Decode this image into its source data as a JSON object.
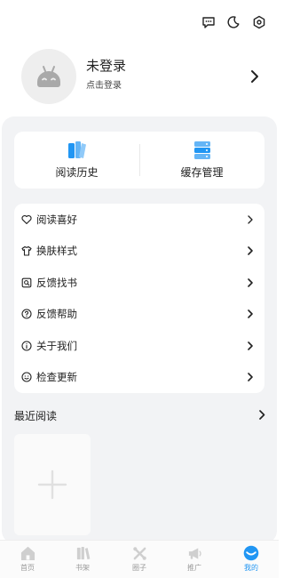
{
  "header": {
    "icons": [
      "message-icon",
      "night-mode-icon",
      "settings-icon"
    ]
  },
  "profile": {
    "name": "未登录",
    "hint": "点击登录"
  },
  "quick_actions": [
    {
      "label": "阅读历史",
      "icon": "book-icon"
    },
    {
      "label": "缓存管理",
      "icon": "database-icon"
    }
  ],
  "menu": [
    {
      "label": "阅读喜好",
      "icon": "heart-icon"
    },
    {
      "label": "换肤样式",
      "icon": "shirt-icon"
    },
    {
      "label": "反馈找书",
      "icon": "search-book-icon"
    },
    {
      "label": "反馈帮助",
      "icon": "help-icon"
    },
    {
      "label": "关于我们",
      "icon": "info-icon"
    },
    {
      "label": "检查更新",
      "icon": "update-icon"
    }
  ],
  "recent": {
    "title": "最近阅读"
  },
  "tabs": [
    {
      "label": "首页",
      "icon": "home-icon",
      "active": false
    },
    {
      "label": "书架",
      "icon": "bookshelf-icon",
      "active": false
    },
    {
      "label": "圈子",
      "icon": "circle-icon",
      "active": false
    },
    {
      "label": "推广",
      "icon": "megaphone-icon",
      "active": false
    },
    {
      "label": "我的",
      "icon": "profile-icon",
      "active": true
    }
  ],
  "colors": {
    "accent": "#2196f3",
    "panel": "#f2f3f5",
    "text": "#222222",
    "muted": "#9a9a9a"
  }
}
